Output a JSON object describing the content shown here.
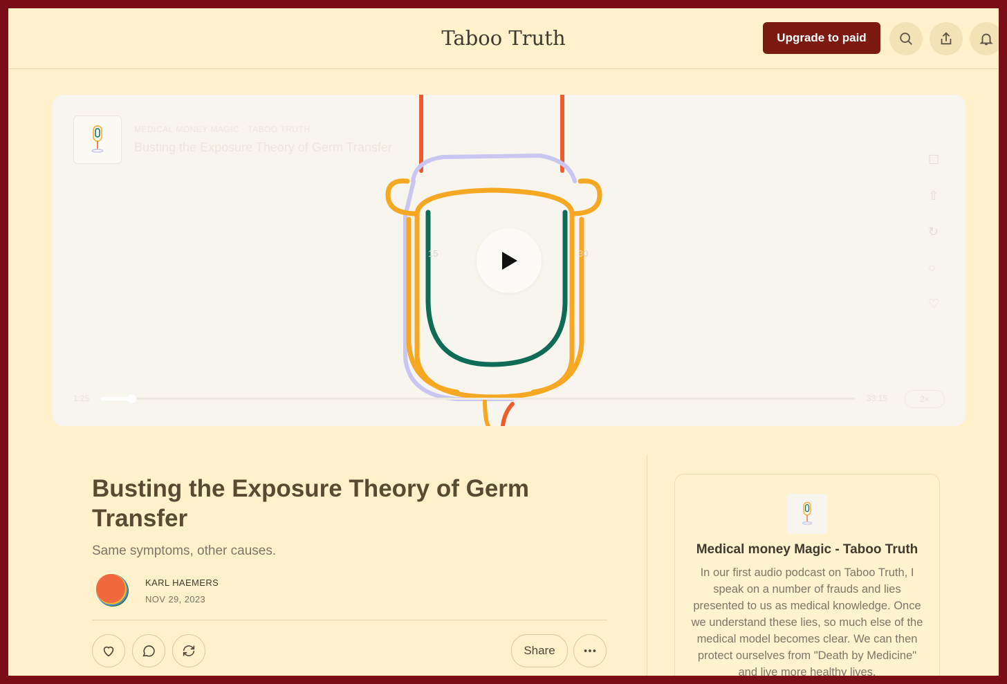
{
  "header": {
    "title": "Taboo Truth",
    "upgrade_label": "Upgrade to paid",
    "icons": [
      "search-icon",
      "share-icon",
      "bell-icon"
    ]
  },
  "player": {
    "meta": "MEDICAL MONEY MAGIC · TABOO TRUTH",
    "title": "Busting the Exposure Theory of Germ Transfer",
    "current_time": "1:25",
    "total_time": "33:15",
    "speed": "2×",
    "progress": 0.04,
    "skip_back": "15",
    "skip_forward": "30"
  },
  "post": {
    "title": "Busting the Exposure Theory of Germ Transfer",
    "subtitle": "Same symptoms, other causes.",
    "author": "KARL HAEMERS",
    "date": "NOV 29, 2023",
    "share_label": "Share"
  },
  "sidebar": {
    "title": "Medical money Magic - Taboo Truth",
    "description": "In our first audio podcast on Taboo Truth, I speak on a number of frauds and lies presented to us as medical knowledge. Once we understand these lies, so much else of the medical model becomes clear. We can then protect ourselves from \"Death by Medicine\" and live more healthy lives."
  },
  "colors": {
    "frame": "#7b0d16",
    "background": "#fff1cc",
    "accent": "#7a1a10",
    "mic_orange": "#f6a823",
    "mic_green": "#0e6b55",
    "mic_lavender": "#c9c6f2",
    "mic_red": "#ec5c2c"
  }
}
